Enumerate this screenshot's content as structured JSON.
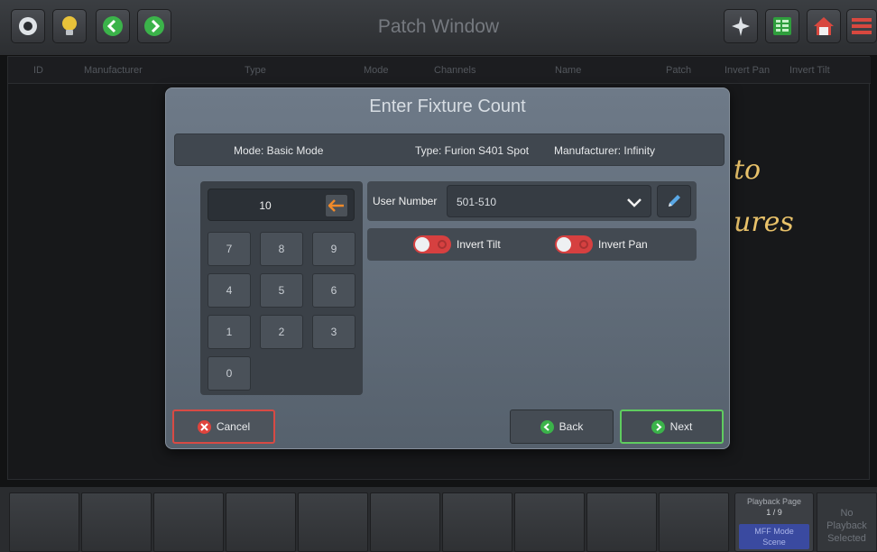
{
  "window": {
    "title": "Patch Window"
  },
  "colors": {
    "accent_red": "#d64040",
    "next_border": "#5fcc5f",
    "cancel_border": "#d84a44",
    "handwriting": "#e9c26a"
  },
  "toolbar": {
    "left_icons": [
      "eye-icon",
      "lightbulb-icon",
      "chevron-left-icon",
      "chevron-right-icon"
    ],
    "right_icons": [
      "magic-wand-icon",
      "grid-icon",
      "home-icon",
      "menu-icon"
    ]
  },
  "table": {
    "columns": [
      "ID",
      "Manufacturer",
      "Type",
      "Mode",
      "Channels",
      "Name",
      "Patch",
      "Invert Pan",
      "Invert Tilt"
    ]
  },
  "background_text": {
    "line1": "to",
    "line2": "ures"
  },
  "dialog": {
    "title": "Enter Fixture Count",
    "mode": "Mode: Basic Mode",
    "type": "Type: Furion S401 Spot",
    "manufacturer": "Manufacturer: Infinity",
    "keypad": {
      "value": "10",
      "keys": [
        "7",
        "8",
        "9",
        "4",
        "5",
        "6",
        "1",
        "2",
        "3",
        "0"
      ]
    },
    "user_number": {
      "label": "User Number",
      "value": "501-510"
    },
    "toggles": {
      "invert_tilt": "Invert Tilt",
      "invert_pan": "Invert Pan"
    },
    "buttons": {
      "cancel": "Cancel",
      "back": "Back",
      "next": "Next"
    }
  },
  "playback": {
    "page_label": "Playback Page",
    "page_value": "1 / 9",
    "mode_line1": "MFF Mode",
    "mode_line2": "Scene",
    "none_line1": "No",
    "none_line2": "Playback",
    "none_line3": "Selected"
  }
}
